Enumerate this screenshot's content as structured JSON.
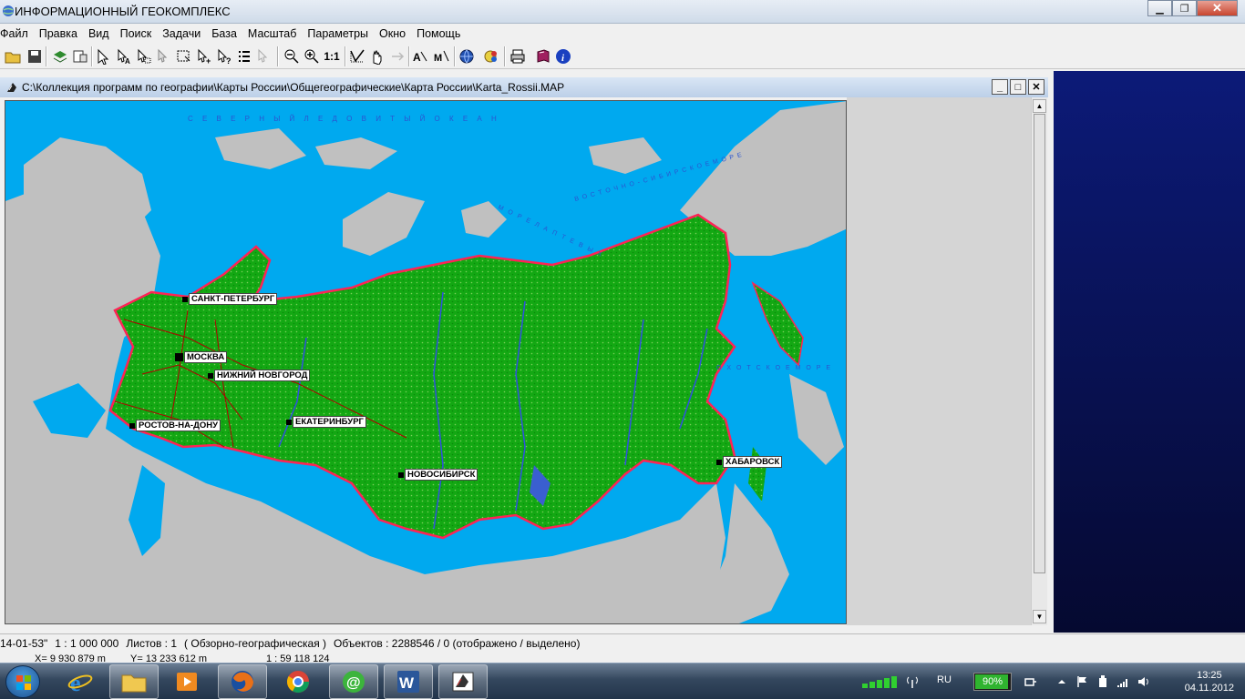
{
  "window": {
    "title": "ИНФОРМАЦИОННЫЙ ГЕОКОМПЛЕКС"
  },
  "menu": [
    "Файл",
    "Правка",
    "Вид",
    "Поиск",
    "Задачи",
    "База",
    "Масштаб",
    "Параметры",
    "Окно",
    "Помощь"
  ],
  "toolbar": {
    "scale_one_label": "1:1"
  },
  "map_window": {
    "title": "C:\\Коллекция программ по географии\\Карты России\\Общегеографические\\Карта России\\Karta_Rossii.MAP"
  },
  "map": {
    "cities": [
      {
        "name": "САНКТ-ПЕТЕРБУРГ"
      },
      {
        "name": "МОСКВА"
      },
      {
        "name": "НИЖНИЙ НОВГОРОД"
      },
      {
        "name": "РОСТОВ-НА-ДОНУ"
      },
      {
        "name": "ЕКАТЕРИНБУРГ"
      },
      {
        "name": "НОВОСИБИРСК"
      },
      {
        "name": "ХАБАРОВСК"
      }
    ],
    "seas": {
      "arctic_ocean": "С Е В Е Р Н Ы Й   Л Е Д О В И Т Ы Й   О К Е А Н",
      "laptev": "М О Р Е  Л А П Т Е В Ы Х",
      "east_siberian": "В О С Т О Ч Н О - С И Б И Р С К О Е  М О Р Е",
      "okhotsk": "О Х О Т С К О Е  М О Р Е"
    },
    "colors": {
      "water": "#00a9ef",
      "land_foreign": "#c0c0c0",
      "land_russia": "#14b014",
      "border": "#ff2255",
      "roads": "#b00000"
    }
  },
  "status": {
    "coords": "14-01-53\"",
    "scale": "1 : 1 000 000",
    "sheets": "Листов : 1",
    "map_type": "( Обзорно-географическая )",
    "objects": "Объектов : 2288546 / 0 (отображено / выделено)",
    "x": "X= 9 930 879 m",
    "y": "Y= 13 233 612 m",
    "ratio": "1 : 59 118 124"
  },
  "taskbar": {
    "language": "RU",
    "battery": "90%",
    "battery_level": 0.9,
    "time": "13:25",
    "date": "04.11.2012"
  }
}
